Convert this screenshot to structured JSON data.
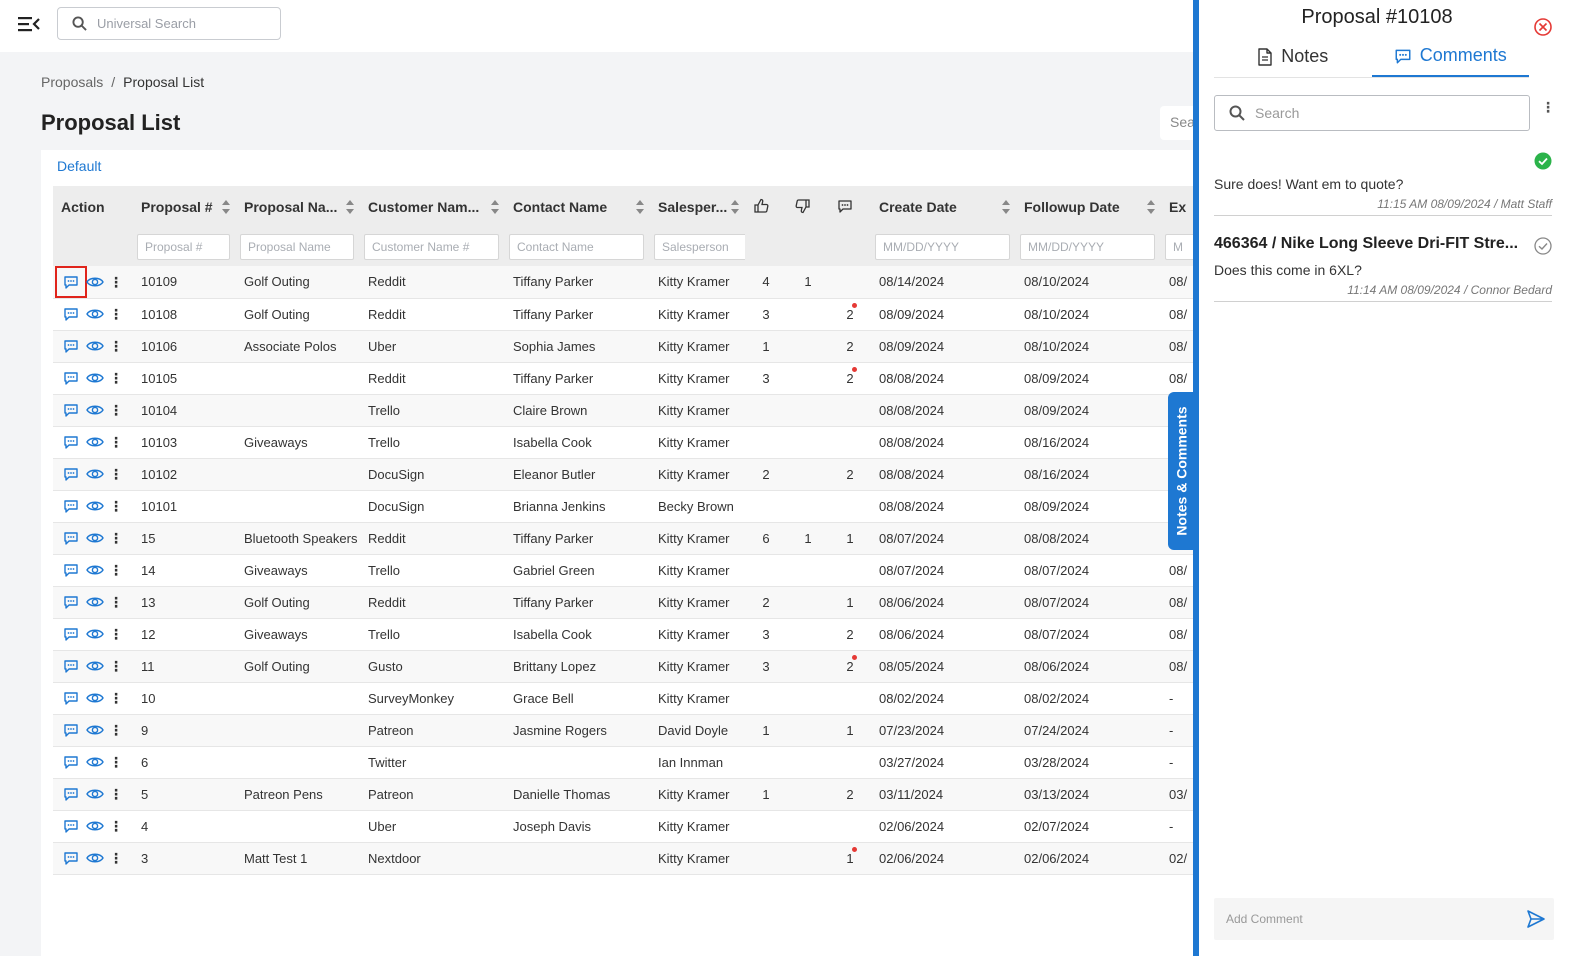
{
  "topbar": {
    "search_placeholder": "Universal Search"
  },
  "breadcrumb": {
    "root": "Proposals",
    "separator": "/",
    "current": "Proposal List"
  },
  "page": {
    "title": "Proposal List",
    "right_search": "Search"
  },
  "view": {
    "default_label": "Default"
  },
  "table": {
    "headers": {
      "action": "Action",
      "proposal_num": "Proposal #",
      "proposal_name": "Proposal Na...",
      "customer_name": "Customer Nam...",
      "contact_name": "Contact Name",
      "salesperson": "Salesper...",
      "create_date": "Create Date",
      "followup_date": "Followup Date",
      "ex": "Ex"
    },
    "filters": {
      "proposal_num": "Proposal #",
      "proposal_name": "Proposal Name",
      "customer_name": "Customer Name #",
      "contact_name": "Contact Name",
      "salesperson": "Salesperson",
      "create_date": "MM/DD/YYYY",
      "followup_date": "MM/DD/YYYY",
      "ex": "M"
    },
    "rows": [
      {
        "num": "10109",
        "name": "Golf Outing",
        "customer": "Reddit",
        "contact": "Tiffany Parker",
        "sales": "Kitty Kramer",
        "likes": "4",
        "dislikes": "1",
        "comments": "",
        "dot": false,
        "create": "08/14/2024",
        "followup": "08/10/2024",
        "ex": "08/"
      },
      {
        "num": "10108",
        "name": "Golf Outing",
        "customer": "Reddit",
        "contact": "Tiffany Parker",
        "sales": "Kitty Kramer",
        "likes": "3",
        "dislikes": "",
        "comments": "2",
        "dot": true,
        "create": "08/09/2024",
        "followup": "08/10/2024",
        "ex": "08/"
      },
      {
        "num": "10106",
        "name": "Associate Polos",
        "customer": "Uber",
        "contact": "Sophia James",
        "sales": "Kitty Kramer",
        "likes": "1",
        "dislikes": "",
        "comments": "2",
        "dot": false,
        "create": "08/09/2024",
        "followup": "08/10/2024",
        "ex": "08/"
      },
      {
        "num": "10105",
        "name": "",
        "customer": "Reddit",
        "contact": "Tiffany Parker",
        "sales": "Kitty Kramer",
        "likes": "3",
        "dislikes": "",
        "comments": "2",
        "dot": true,
        "create": "08/08/2024",
        "followup": "08/09/2024",
        "ex": "08/"
      },
      {
        "num": "10104",
        "name": "",
        "customer": "Trello",
        "contact": "Claire Brown",
        "sales": "Kitty Kramer",
        "likes": "",
        "dislikes": "",
        "comments": "",
        "dot": false,
        "create": "08/08/2024",
        "followup": "08/09/2024",
        "ex": ""
      },
      {
        "num": "10103",
        "name": "Giveaways",
        "customer": "Trello",
        "contact": "Isabella Cook",
        "sales": "Kitty Kramer",
        "likes": "",
        "dislikes": "",
        "comments": "",
        "dot": false,
        "create": "08/08/2024",
        "followup": "08/16/2024",
        "ex": ""
      },
      {
        "num": "10102",
        "name": "",
        "customer": "DocuSign",
        "contact": "Eleanor Butler",
        "sales": "Kitty Kramer",
        "likes": "2",
        "dislikes": "",
        "comments": "2",
        "dot": false,
        "create": "08/08/2024",
        "followup": "08/16/2024",
        "ex": ""
      },
      {
        "num": "10101",
        "name": "",
        "customer": "DocuSign",
        "contact": "Brianna Jenkins",
        "sales": "Becky Brown",
        "likes": "",
        "dislikes": "",
        "comments": "",
        "dot": false,
        "create": "08/08/2024",
        "followup": "08/09/2024",
        "ex": ""
      },
      {
        "num": "15",
        "name": "Bluetooth Speakers",
        "customer": "Reddit",
        "contact": "Tiffany Parker",
        "sales": "Kitty Kramer",
        "likes": "6",
        "dislikes": "1",
        "comments": "1",
        "dot": false,
        "create": "08/07/2024",
        "followup": "08/08/2024",
        "ex": ""
      },
      {
        "num": "14",
        "name": "Giveaways",
        "customer": "Trello",
        "contact": "Gabriel Green",
        "sales": "Kitty Kramer",
        "likes": "",
        "dislikes": "",
        "comments": "",
        "dot": false,
        "create": "08/07/2024",
        "followup": "08/07/2024",
        "ex": "08/"
      },
      {
        "num": "13",
        "name": "Golf Outing",
        "customer": "Reddit",
        "contact": "Tiffany Parker",
        "sales": "Kitty Kramer",
        "likes": "2",
        "dislikes": "",
        "comments": "1",
        "dot": false,
        "create": "08/06/2024",
        "followup": "08/07/2024",
        "ex": "08/"
      },
      {
        "num": "12",
        "name": "Giveaways",
        "customer": "Trello",
        "contact": "Isabella Cook",
        "sales": "Kitty Kramer",
        "likes": "3",
        "dislikes": "",
        "comments": "2",
        "dot": false,
        "create": "08/06/2024",
        "followup": "08/07/2024",
        "ex": "08/"
      },
      {
        "num": "11",
        "name": "Golf Outing",
        "customer": "Gusto",
        "contact": "Brittany Lopez",
        "sales": "Kitty Kramer",
        "likes": "3",
        "dislikes": "",
        "comments": "2",
        "dot": true,
        "create": "08/05/2024",
        "followup": "08/06/2024",
        "ex": "08/"
      },
      {
        "num": "10",
        "name": "",
        "customer": "SurveyMonkey",
        "contact": "Grace Bell",
        "sales": "Kitty Kramer",
        "likes": "",
        "dislikes": "",
        "comments": "",
        "dot": false,
        "create": "08/02/2024",
        "followup": "08/02/2024",
        "ex": "-"
      },
      {
        "num": "9",
        "name": "",
        "customer": "Patreon",
        "contact": "Jasmine Rogers",
        "sales": "David Doyle",
        "likes": "1",
        "dislikes": "",
        "comments": "1",
        "dot": false,
        "create": "07/23/2024",
        "followup": "07/24/2024",
        "ex": "-"
      },
      {
        "num": "6",
        "name": "",
        "customer": "Twitter",
        "contact": "",
        "sales": "Ian Innman",
        "likes": "",
        "dislikes": "",
        "comments": "",
        "dot": false,
        "create": "03/27/2024",
        "followup": "03/28/2024",
        "ex": "-"
      },
      {
        "num": "5",
        "name": "Patreon Pens",
        "customer": "Patreon",
        "contact": "Danielle Thomas",
        "sales": "Kitty Kramer",
        "likes": "1",
        "dislikes": "",
        "comments": "2",
        "dot": false,
        "create": "03/11/2024",
        "followup": "03/13/2024",
        "ex": "03/"
      },
      {
        "num": "4",
        "name": "",
        "customer": "Uber",
        "contact": "Joseph Davis",
        "sales": "Kitty Kramer",
        "likes": "",
        "dislikes": "",
        "comments": "",
        "dot": false,
        "create": "02/06/2024",
        "followup": "02/07/2024",
        "ex": "-"
      },
      {
        "num": "3",
        "name": "Matt Test 1",
        "customer": "Nextdoor",
        "contact": "",
        "sales": "Kitty Kramer",
        "likes": "",
        "dislikes": "",
        "comments": "1",
        "dot": true,
        "create": "02/06/2024",
        "followup": "02/06/2024",
        "ex": "02/"
      }
    ]
  },
  "side_tab": {
    "label": "Notes & Comments"
  },
  "panel": {
    "title": "Proposal #10108",
    "tabs": {
      "notes": "Notes",
      "comments": "Comments"
    },
    "search_placeholder": "Search",
    "comments": [
      {
        "header": "",
        "text": "Sure does! Want em to quote?",
        "meta": "11:15 AM 08/09/2024 / Matt Staff",
        "resolved": true
      },
      {
        "header": "466364 / Nike Long Sleeve Dri-FIT Stre...",
        "text": "Does this come in 6XL?",
        "meta": "11:14 AM 08/09/2024 / Connor Bedard",
        "resolved": false
      }
    ],
    "add_comment_placeholder": "Add Comment"
  },
  "colors": {
    "accent": "#1e78d2",
    "highlight": "#e0241b",
    "resolved": "#2bb34a",
    "notification_dot": "#e53935"
  }
}
